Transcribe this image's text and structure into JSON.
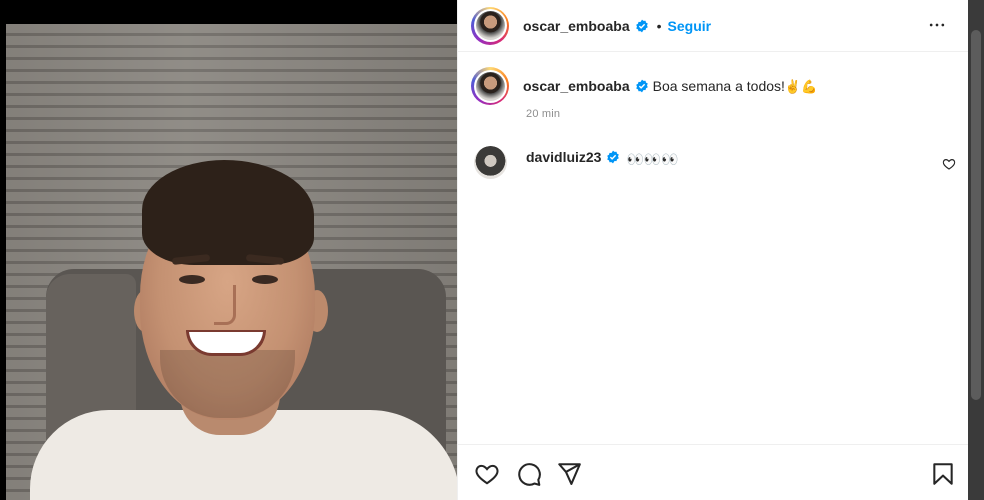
{
  "post": {
    "author": "oscar_emboaba",
    "follow_label": "Seguir",
    "dot": "•",
    "caption": "Boa semana a todos!",
    "caption_emojis": [
      "✌️",
      "💪"
    ],
    "time": "20 min"
  },
  "comments": [
    {
      "author": "davidluiz23",
      "text_emoji": "👀👀👀"
    }
  ],
  "icons": {
    "verified": "verified-badge-icon",
    "more": "more-options-icon",
    "like": "heart-icon",
    "comment": "comment-icon",
    "share": "share-icon",
    "save": "bookmark-icon"
  },
  "colors": {
    "accent": "#0095f6",
    "text": "#262626",
    "muted": "#8e8e8e"
  }
}
